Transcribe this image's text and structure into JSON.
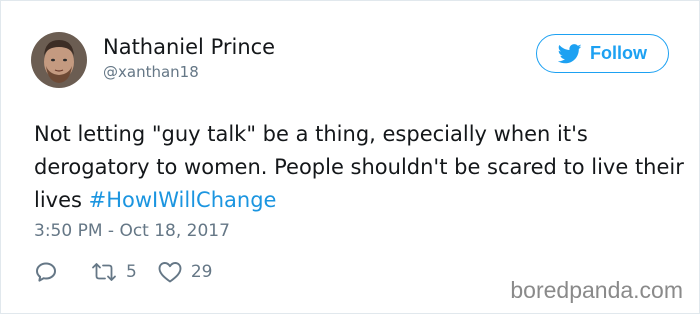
{
  "tweet": {
    "author": {
      "display_name": "Nathaniel Prince",
      "handle": "@xanthan18",
      "avatar_icon": "user-avatar-photo"
    },
    "follow_button": {
      "label": "Follow",
      "icon": "twitter-bird-icon"
    },
    "text": "Not letting \"guy talk\" be a thing, especially when it's derogatory to women. People shouldn't be scared to live their lives ",
    "hashtag": "#HowIWillChange",
    "timestamp": "3:50 PM - Oct 18, 2017",
    "actions": {
      "reply_icon": "reply-icon",
      "retweet_icon": "retweet-icon",
      "retweet_count": "5",
      "like_icon": "heart-icon",
      "like_count": "29"
    }
  },
  "watermark": "boredpanda.com",
  "colors": {
    "accent": "#1da1f2",
    "hashtag": "#1b95e0",
    "text": "#14171a",
    "secondary": "#657786"
  }
}
